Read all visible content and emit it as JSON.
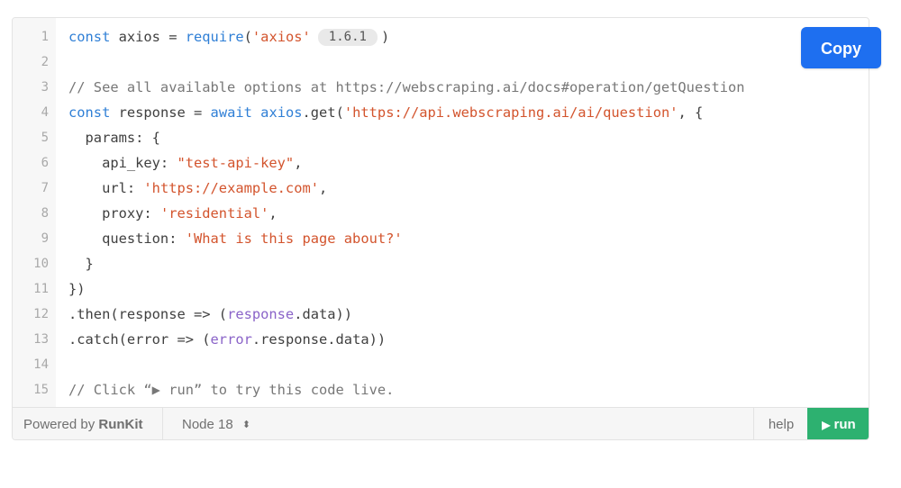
{
  "code_lines": [
    {
      "n": "1",
      "parts": [
        {
          "t": "const",
          "c": "kw"
        },
        {
          "t": " axios = ",
          "c": ""
        },
        {
          "t": "require",
          "c": "kw"
        },
        {
          "t": "(",
          "c": ""
        },
        {
          "t": "'axios'",
          "c": "str"
        },
        {
          "t": "1.6.1",
          "c": "pill"
        },
        {
          "t": ")",
          "c": ""
        }
      ]
    },
    {
      "n": "2",
      "parts": []
    },
    {
      "n": "3",
      "parts": [
        {
          "t": "// See all available options at https://webscraping.ai/docs#operation/getQuestion",
          "c": "cm"
        }
      ]
    },
    {
      "n": "4",
      "parts": [
        {
          "t": "const",
          "c": "kw"
        },
        {
          "t": " response = ",
          "c": ""
        },
        {
          "t": "await",
          "c": "kw"
        },
        {
          "t": " ",
          "c": ""
        },
        {
          "t": "axios",
          "c": "kw"
        },
        {
          "t": ".get(",
          "c": ""
        },
        {
          "t": "'https://api.webscraping.ai/ai/question'",
          "c": "str"
        },
        {
          "t": ", {",
          "c": ""
        }
      ]
    },
    {
      "n": "5",
      "parts": [
        {
          "t": "  params: {",
          "c": ""
        }
      ]
    },
    {
      "n": "6",
      "parts": [
        {
          "t": "    api_key: ",
          "c": ""
        },
        {
          "t": "\"test-api-key\"",
          "c": "str"
        },
        {
          "t": ",",
          "c": ""
        }
      ]
    },
    {
      "n": "7",
      "parts": [
        {
          "t": "    url: ",
          "c": ""
        },
        {
          "t": "'https://example.com'",
          "c": "str"
        },
        {
          "t": ",",
          "c": ""
        }
      ]
    },
    {
      "n": "8",
      "parts": [
        {
          "t": "    proxy: ",
          "c": ""
        },
        {
          "t": "'residential'",
          "c": "str"
        },
        {
          "t": ",",
          "c": ""
        }
      ]
    },
    {
      "n": "9",
      "parts": [
        {
          "t": "    question: ",
          "c": ""
        },
        {
          "t": "'What is this page about?'",
          "c": "str"
        }
      ]
    },
    {
      "n": "10",
      "parts": [
        {
          "t": "  }",
          "c": ""
        }
      ]
    },
    {
      "n": "11",
      "parts": [
        {
          "t": "})",
          "c": ""
        }
      ]
    },
    {
      "n": "12",
      "parts": [
        {
          "t": ".then(response => (",
          "c": ""
        },
        {
          "t": "response",
          "c": "ref"
        },
        {
          "t": ".data))",
          "c": ""
        }
      ]
    },
    {
      "n": "13",
      "parts": [
        {
          "t": ".catch(error => (",
          "c": ""
        },
        {
          "t": "error",
          "c": "ref"
        },
        {
          "t": ".response.data))",
          "c": ""
        }
      ]
    },
    {
      "n": "14",
      "parts": []
    },
    {
      "n": "15",
      "parts": [
        {
          "t": "// Click “▶ run” to try this code live.",
          "c": "cm"
        }
      ]
    }
  ],
  "copy_button": {
    "label": "Copy"
  },
  "footer": {
    "powered_prefix": "Powered by ",
    "powered_brand": "RunKit",
    "node_version": "Node 18",
    "node_caret_icon": "sort-icon",
    "help_label": "help",
    "run_label": "run",
    "run_icon": "play-icon"
  },
  "colors": {
    "keyword": "#2f7fd6",
    "string": "#d3542d",
    "comment": "#777777",
    "reference": "#8a63c8",
    "copy_button": "#1e6ff0",
    "run_button": "#2db170"
  }
}
